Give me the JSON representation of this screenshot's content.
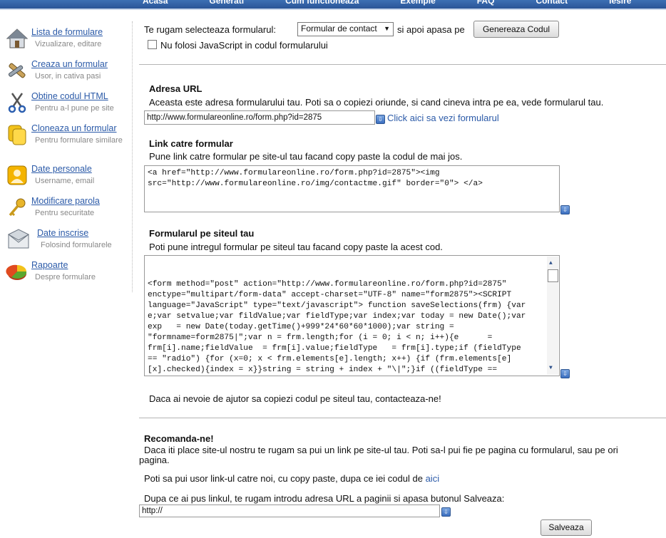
{
  "topnav": [
    "Acasa",
    "Generati",
    "Cum functioneaza",
    "Exemple",
    "FAQ",
    "Contact",
    "Iesire"
  ],
  "sidebar": {
    "items": [
      {
        "title": "Lista de formulare",
        "sub": "Vizualizare, editare",
        "icon": "house-icon"
      },
      {
        "title": "Creaza un formular",
        "sub": "Usor, in cativa pasi",
        "icon": "wrench-icon"
      },
      {
        "title": "Obtine codul HTML",
        "sub": "Pentru a-l pune pe site",
        "icon": "scissors-icon"
      },
      {
        "title": "Cloneaza un formular",
        "sub": "Pentru formulare similare",
        "icon": "clone-icon"
      },
      {
        "title": "Date personale",
        "sub": "Username, email",
        "icon": "user-icon"
      },
      {
        "title": "Modificare parola",
        "sub": "Pentru securitate",
        "icon": "key-icon"
      },
      {
        "title": "Date inscrise",
        "sub": "Folosind formularele",
        "icon": "mail-icon"
      },
      {
        "title": "Rapoarte",
        "sub": "Despre formulare",
        "icon": "pie-chart-icon"
      }
    ]
  },
  "form_select": {
    "prompt": "Te rugam selecteaza formularul:",
    "selected": "Formular de contact",
    "after": "si apoi apasa pe",
    "button": "Genereaza Codul",
    "no_js_label": "Nu folosi JavaScript in codul formularului"
  },
  "url_section": {
    "title": "Adresa URL",
    "desc": "Aceasta este adresa formularului tau. Poti sa o copiezi oriunde, si cand cineva intra pe ea, vede formularul tau.",
    "value": "http://www.formulareonline.ro/form.php?id=2875",
    "link": "Click aici sa vezi formularul"
  },
  "link_section": {
    "title": "Link catre formular",
    "desc": "Pune link catre formular pe site-ul tau facand copy paste la codul de mai jos.",
    "code": "<a href=\"http://www.formulareonline.ro/form.php?id=2875\"><img\nsrc=\"http://www.formulareonline.ro/img/contactme.gif\" border=\"0\"> </a>"
  },
  "form_section": {
    "title": "Formularul pe siteul tau",
    "desc": "Poti pune intregul formular pe siteul tau facand copy paste la acest cod.",
    "code": "\n<form method=\"post\" action=\"http://www.formulareonline.ro/form.php?id=2875\"\nenctype=\"multipart/form-data\" accept-charset=\"UTF-8\" name=\"form2875\"><SCRIPT\nlanguage=\"JavaScript\" type=\"text/javascript\"> function saveSelections(frm) {var\ne;var setvalue;var fildValue;var fieldType;var index;var today = new Date();var\nexp   = new Date(today.getTime()+999*24*60*60*1000);var string =\n\"formname=form2875|\";var n = frm.length;for (i = 0; i < n; i++){e      =\nfrm[i].name;fieldValue  = frm[i].value;fieldType   = frm[i].type;if (fieldType\n== \"radio\") {for (x=0; x < frm.elements[e].length; x++) {if (frm.elements[e]\n[x].checked){index = x}}string = string + index + \"\\|\";}if ((fieldType ==\n\"text\") ||    (fieldType == \"textarea\") ||    (fieldType == \"select-one\")){",
    "help": "Daca ai nevoie de ajutor sa copiezi codul pe siteul tau, contacteaza-ne!"
  },
  "recommend": {
    "title": "Recomanda-ne!",
    "desc_line1": "Daca iti place site-ul nostru te rugam sa pui un link pe site-ul tau. Poti sa-l pui fie pe pagina cu formularul, sau pe ori",
    "desc_line2": "pagina.",
    "copy_prefix": "Poti sa pui usor link-ul catre noi, cu copy paste, dupa ce iei codul de",
    "copy_link": "aici",
    "url_prompt": "Dupa ce ai pus linkul, te rugam introdu adresa URL a paginii si apasa butonul Salveaza:",
    "url_value": "http://",
    "save_button": "Salveaza"
  },
  "colors": {
    "link": "#2b5aa8",
    "topbar": "#2a5597"
  }
}
